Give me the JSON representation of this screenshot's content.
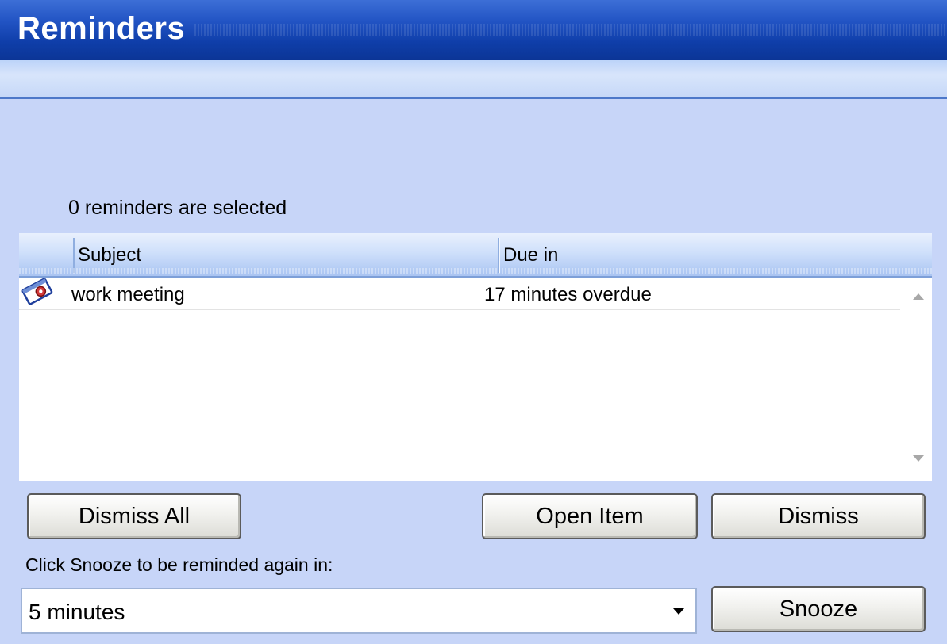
{
  "window": {
    "title": "Reminders"
  },
  "status": {
    "selected_count_text": "0 reminders are selected"
  },
  "list": {
    "columns": [
      "Subject",
      "Due in"
    ],
    "rows": [
      {
        "icon": "calendar-reminder-icon",
        "subject": "work meeting",
        "due_in": "17 minutes overdue"
      }
    ]
  },
  "buttons": {
    "dismiss_all": "Dismiss All",
    "open_item": "Open Item",
    "dismiss": "Dismiss",
    "snooze": "Snooze"
  },
  "snooze": {
    "label": "Click Snooze to be reminded again in:",
    "selected_value": "5 minutes"
  },
  "colors": {
    "title_bar": "#0f3ea9",
    "background": "#c7d5f8",
    "header_gradient_bottom": "#a9c4f2"
  }
}
